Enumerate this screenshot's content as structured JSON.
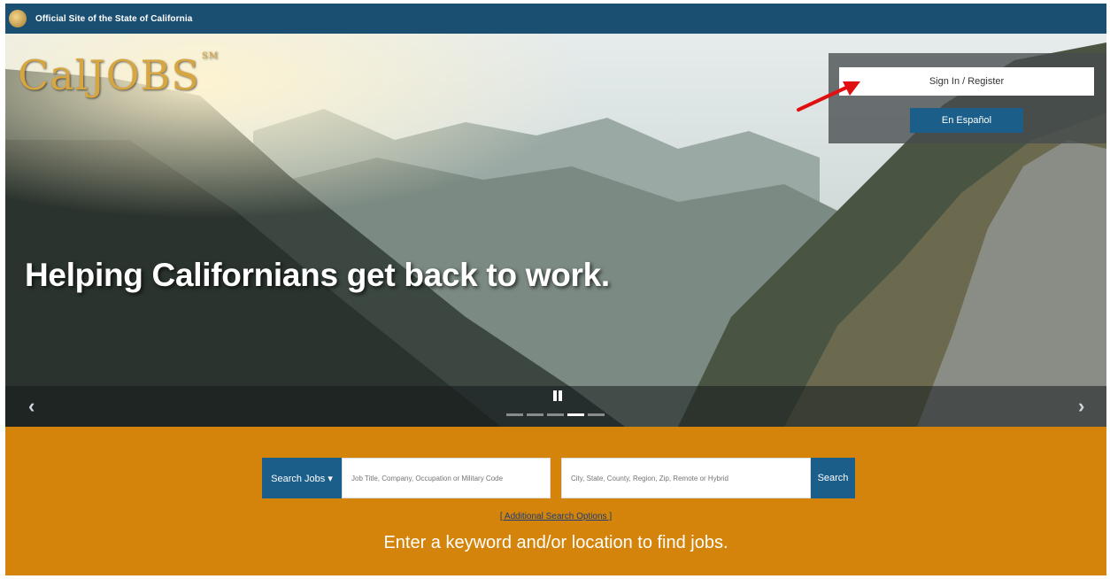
{
  "state_bar": {
    "text": "Official Site of the State of California",
    "icon": "california-seal-icon",
    "color": "#1b4f72"
  },
  "brand": {
    "name": "CalJOBS",
    "mark": "SM",
    "color": "#d8a640"
  },
  "hero": {
    "headline": "Helping Californians get back to work.",
    "carousel": {
      "prev_icon": "chevron-left-icon",
      "next_icon": "chevron-right-icon",
      "prev_glyph": "‹",
      "next_glyph": "›",
      "pause_icon": "pause-icon",
      "slides": 5,
      "active_slide": 4
    }
  },
  "auth": {
    "signin_label": "Sign In / Register",
    "espanol_label": "En Español",
    "accent": "#1b5e8a"
  },
  "search": {
    "jobs_button_label": "Search Jobs ▾",
    "keyword_placeholder": "Job Title, Company, Occupation or Military Code",
    "location_placeholder": "City, State, County, Region, Zip, Remote or Hybrid",
    "search_button_label": "Search",
    "additional_options_label": "[ Additional Search Options ]",
    "tagline": "Enter a keyword and/or location to find jobs.",
    "background": "#d4840a"
  }
}
